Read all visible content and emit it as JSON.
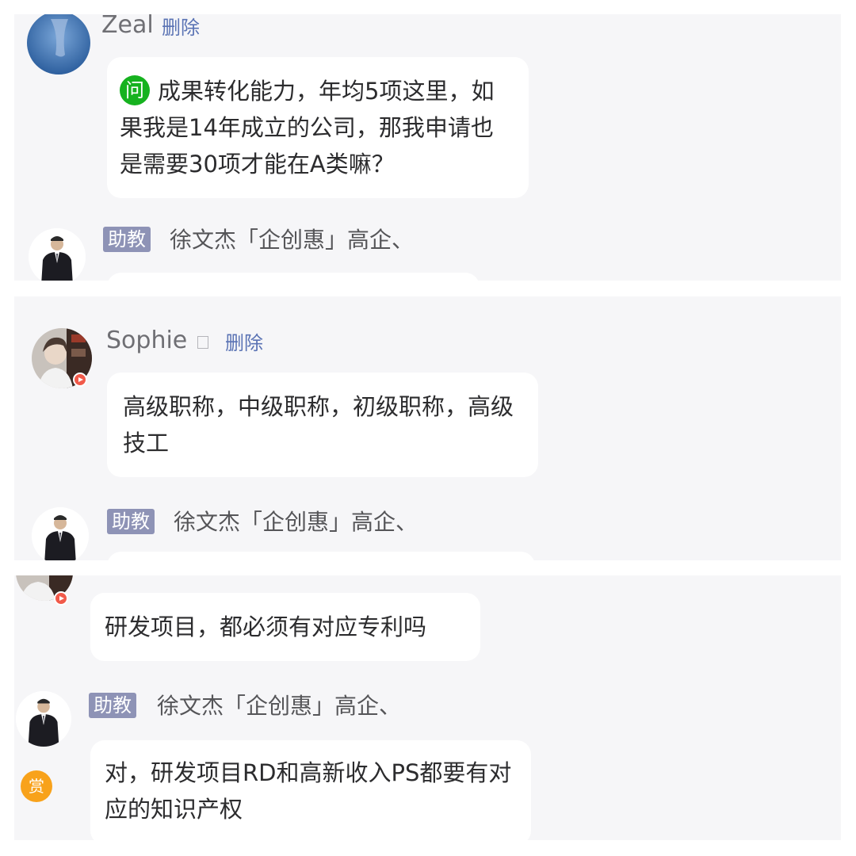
{
  "messages": [
    {
      "user": "Zeal",
      "delete_label": "删除",
      "question_badge": "问",
      "text": "成果转化能力，年均5项这里，如果我是14年成立的公司，那我申请也是需要30项才能在A类嘛？"
    },
    {
      "user": "Sophie",
      "delete_label": "删除",
      "text": "高级职称，中级职称，初级职称，高级技工"
    },
    {
      "text": "研发项目，都必须有对应专利吗"
    }
  ],
  "assistant": {
    "role_tag": "助教",
    "name": "徐文杰「企创惠」高企、",
    "reply": "对，研发项目RD和高新收入PS都要有对应的知识产权",
    "reward_icon_label": "赏"
  },
  "colors": {
    "panel_bg": "#f6f6f8",
    "bubble_bg": "#ffffff",
    "role_tag_bg": "#8e93b6",
    "delete_link": "#5a73b4",
    "question_badge": "#16b21f",
    "reward_icon": "#f8a21b"
  }
}
